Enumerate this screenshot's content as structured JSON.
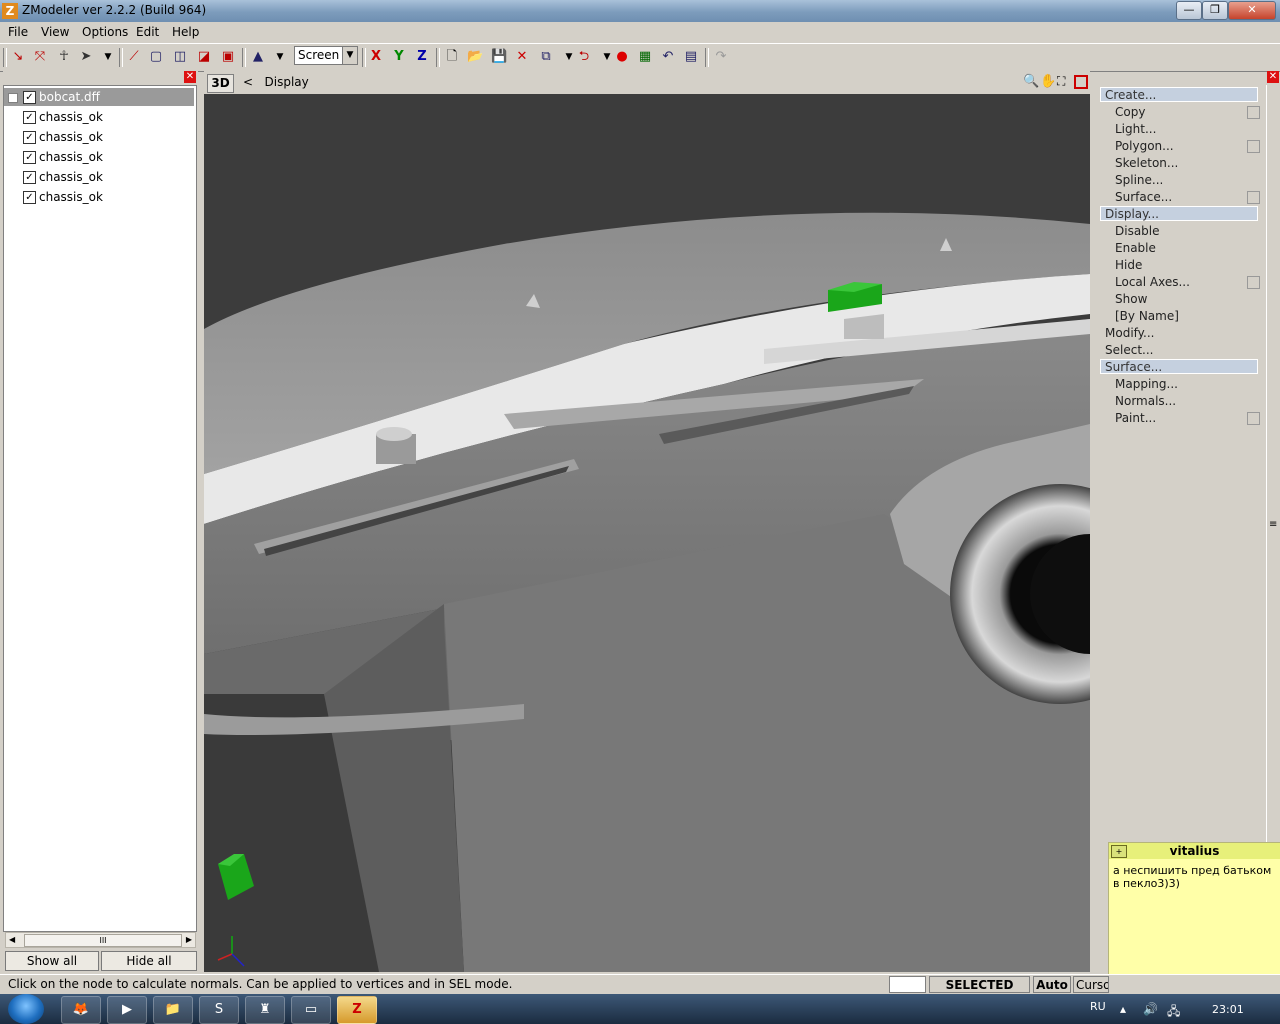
{
  "window": {
    "title": "ZModeler ver 2.2.2 (Build 964)",
    "icon": "Z"
  },
  "titlebar_buttons": {
    "minimize": "—",
    "maximize": "❐",
    "close": "✕"
  },
  "menu": [
    "File",
    "View",
    "Options",
    "Edit",
    "Help"
  ],
  "toolbar": {
    "view_select": "Screen",
    "axis_x": "X",
    "axis_y": "Y",
    "axis_z": "Z"
  },
  "tree": {
    "items": [
      {
        "label": "bobcat.dff",
        "checked": true,
        "selected": true
      },
      {
        "label": "chassis_ok",
        "checked": true
      },
      {
        "label": "chassis_ok",
        "checked": true
      },
      {
        "label": "chassis_ok",
        "checked": true
      },
      {
        "label": "chassis_ok",
        "checked": true
      },
      {
        "label": "chassis_ok",
        "checked": true
      }
    ],
    "scroll_thumb": "III",
    "show_all": "Show all",
    "hide_all": "Hide all"
  },
  "viewport": {
    "label": "3D",
    "back": "<",
    "mode": "Display"
  },
  "right_panel": {
    "create": {
      "header": "Create...",
      "items": [
        "Copy",
        "Light...",
        "Polygon...",
        "Skeleton...",
        "Spline...",
        "Surface..."
      ]
    },
    "display": {
      "header": "Display...",
      "items": [
        "Disable",
        "Enable",
        "Hide",
        "Local Axes...",
        "Show",
        "[By Name]"
      ]
    },
    "modify": "Modify...",
    "select": "Select...",
    "surface": {
      "header": "Surface...",
      "items": [
        "Mapping...",
        "Normals...",
        "Paint..."
      ]
    }
  },
  "note": {
    "author": "vitalius",
    "text": "а неспишить пред батьком в пекло3)3)"
  },
  "statusbar": {
    "message": "Click on the node to calculate normals. Can be applied to vertices and in SEL mode.",
    "mode": "SELECTED MODE",
    "auto": "Auto",
    "cursor": "Cursor"
  },
  "taskbar": {
    "lang": "RU",
    "time": "23:01",
    "active_app": "Z"
  },
  "colors": {
    "accent_green": "#1aa61a",
    "viewport_bg": "#3c3c3c",
    "selection_header": "#c5d0df"
  }
}
